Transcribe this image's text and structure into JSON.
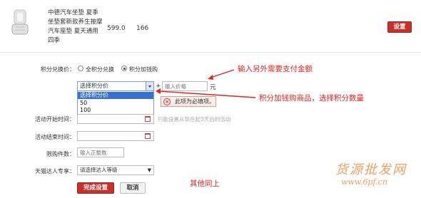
{
  "product": {
    "image_icon": "car-seat-cushion-thumbnail",
    "title": "中德汽车坐垫 夏季坐垫套新款养生按摩汽车座垫 夏天通用四季",
    "price": "599.0",
    "stock": "166",
    "set_label": "设置"
  },
  "exchange": {
    "label": "积分兑换价：",
    "option_full": "全积分兑换",
    "option_plus": "积分加钱购",
    "selected": "option_plus"
  },
  "points_select": {
    "value": "选择积分价",
    "options": [
      "选择积分价",
      "50",
      "100"
    ],
    "highlighted_index": 0
  },
  "plus_sign": "+",
  "price_input": {
    "placeholder": "输入价格",
    "unit": "元"
  },
  "error": {
    "icon": "error-x-icon",
    "text": "此项为必填项。"
  },
  "start_time": {
    "label": "活动开始时间：",
    "hint": "只能设置从现在起3天后的活动",
    "icon": "calendar-icon"
  },
  "end_time": {
    "label": "活动结束时间：",
    "icon": "calendar-icon"
  },
  "limit": {
    "label": "限购件数：",
    "placeholder": "输入正整数"
  },
  "vip": {
    "label": "天猫达人专享：",
    "value": "请选择达人等级"
  },
  "buttons": {
    "finish": "完成设置",
    "cancel": "取消"
  },
  "annotations": {
    "price_note": "输入另外需要支付金额",
    "points_note": "积分加钱购商品，选择积分数量",
    "others_note": "其他同上"
  },
  "watermark": {
    "text": "货源批发网",
    "url": "www.6pf.cn"
  },
  "colors": {
    "annotation": "#e3231f",
    "primary_button": "#c9302c",
    "select_highlight": "#3670d3",
    "watermark": "#f0a060"
  }
}
